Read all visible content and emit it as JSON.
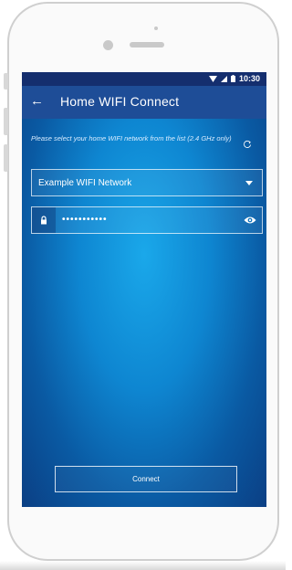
{
  "status_bar": {
    "time": "10:30"
  },
  "app_bar": {
    "back_icon": "arrow-left-icon",
    "title": "Home WIFI Connect"
  },
  "form": {
    "hint": "Please select your home WIFI network from the list (2.4 GHz only)",
    "network_value": "Example WIFI Network",
    "password_value": "•••••••••••",
    "connect_label": "Connect"
  },
  "colors": {
    "appbar": "#1e4d97",
    "statusbar": "#142e6e",
    "screen_center": "#1aa8ea",
    "screen_edge": "#0b3f84"
  },
  "icons": [
    "wifi-icon",
    "signal-icon",
    "battery-icon",
    "arrow-left-icon",
    "refresh-icon",
    "chevron-down-icon",
    "lock-icon",
    "eye-icon"
  ]
}
